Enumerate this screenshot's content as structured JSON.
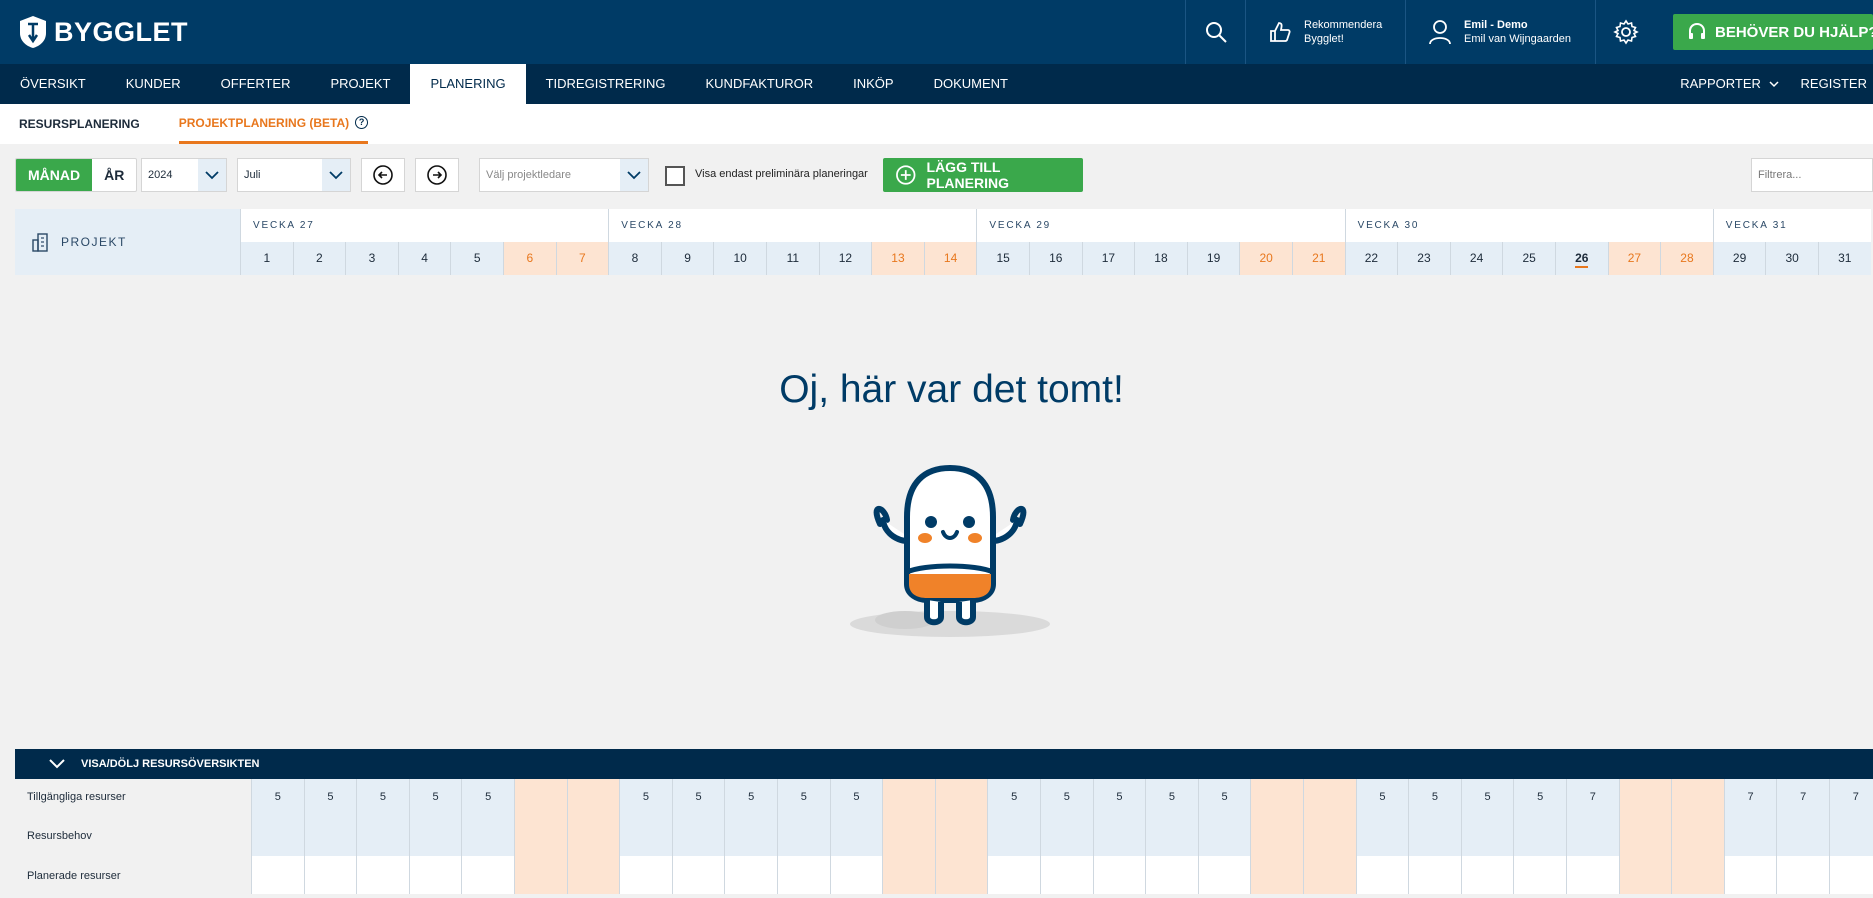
{
  "brand": {
    "name": "BYGGLET"
  },
  "header": {
    "recommend_line1": "Rekommendera",
    "recommend_line2": "Bygglet!",
    "user_name": "Emil - Demo",
    "user_company": "Emil van Wijngaarden",
    "help_label": "BEHÖVER DU HJÄLP?"
  },
  "nav": {
    "items": [
      "ÖVERSIKT",
      "KUNDER",
      "OFFERTER",
      "PROJEKT",
      "PLANERING",
      "TIDREGISTRERING",
      "KUNDFAKTUROR",
      "INKÖP",
      "DOKUMENT"
    ],
    "active": "PLANERING",
    "reports_label": "RAPPORTER",
    "register_label": "REGISTER"
  },
  "subnav": {
    "items": [
      "RESURSPLANERING",
      "PROJEKTPLANERING (BETA)"
    ],
    "active": "PROJEKTPLANERING (BETA)"
  },
  "toolbar": {
    "month_label": "MÅNAD",
    "year_label": "ÅR",
    "year_value": "2024",
    "month_value": "Juli",
    "project_leader_placeholder": "Välj projektledare",
    "preliminary_label": "Visa endast preliminära planeringar",
    "add_label": "LÄGG TILL PLANERING",
    "filter_placeholder": "Filtrera..."
  },
  "calendar": {
    "project_header": "PROJEKT",
    "weeks": [
      {
        "label": "VECKA 27",
        "days": [
          1,
          2,
          3,
          4,
          5,
          6,
          7
        ]
      },
      {
        "label": "VECKA 28",
        "days": [
          8,
          9,
          10,
          11,
          12,
          13,
          14
        ]
      },
      {
        "label": "VECKA 29",
        "days": [
          15,
          16,
          17,
          18,
          19,
          20,
          21
        ]
      },
      {
        "label": "VECKA 30",
        "days": [
          22,
          23,
          24,
          25,
          26,
          27,
          28
        ]
      },
      {
        "label": "VECKA 31",
        "days": [
          29,
          30,
          31
        ]
      }
    ],
    "weekend_days": [
      6,
      7,
      13,
      14,
      20,
      21,
      27,
      28
    ],
    "today": 26
  },
  "empty_state": {
    "title": "Oj, här var det tomt!"
  },
  "resources": {
    "toggle_label": "VISA/DÖLJ RESURSÖVERSIKTEN",
    "rows": [
      "Tillgängliga resurser",
      "Resursbehov",
      "Planerade resurser"
    ],
    "available": [
      5,
      5,
      5,
      5,
      5,
      null,
      null,
      5,
      5,
      5,
      5,
      5,
      null,
      null,
      5,
      5,
      5,
      5,
      5,
      null,
      null,
      5,
      5,
      5,
      5,
      7,
      null,
      null,
      7,
      7,
      7
    ]
  },
  "colors": {
    "brand_dark": "#003b66",
    "nav_dark": "#002a4b",
    "green": "#3aa84b",
    "orange": "#e8771d"
  }
}
